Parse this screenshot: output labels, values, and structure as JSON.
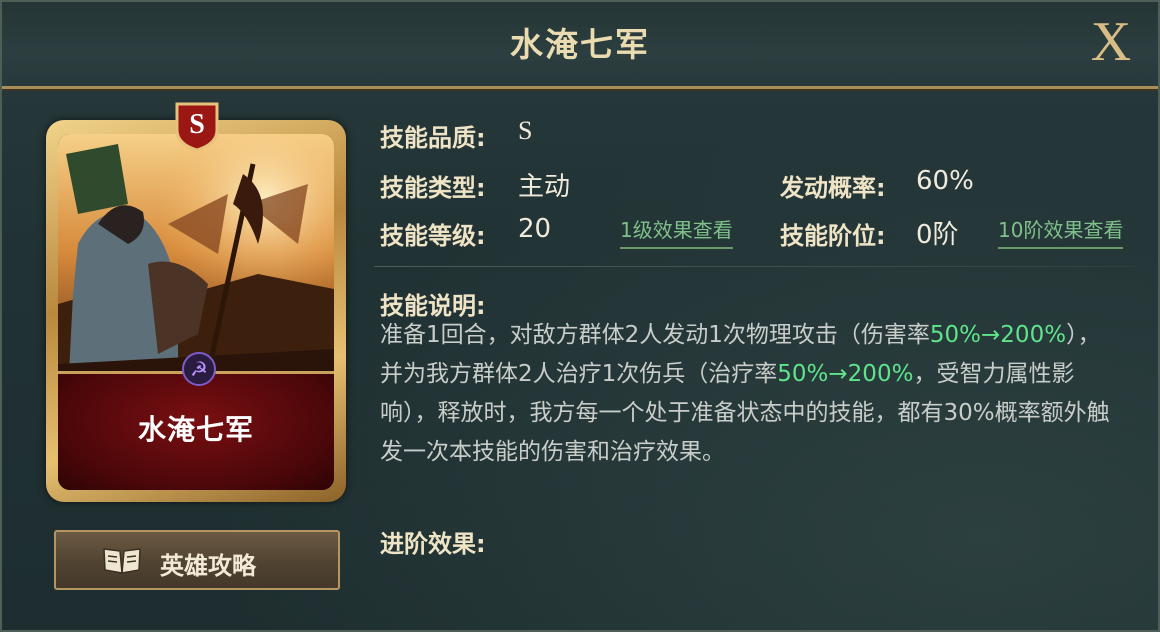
{
  "title": "水淹七军",
  "close_label": "X",
  "card": {
    "name": "水淹七军",
    "grade": "S"
  },
  "guide_button": {
    "label": "英雄攻略"
  },
  "info": {
    "quality_label": "技能品质:",
    "quality_value": "S",
    "type_label": "技能类型:",
    "type_value": "主动",
    "rate_label": "发动概率:",
    "rate_value": "60%",
    "level_label": "技能等级:",
    "level_value": "20",
    "level_link": "1级效果查看",
    "tier_label": "技能阶位:",
    "tier_value": "0阶",
    "tier_link": "10阶效果查看"
  },
  "description": {
    "label": "技能说明:",
    "p1": "准备1回合，对敌方群体2人发动1次物理攻击（伤害率",
    "h1": "50%→200%",
    "p2": "），并为我方群体2人治疗1次伤兵（治疗率",
    "h2": "50%→200%",
    "p3": "，受智力属性影响），释放时，我方每一个处于准备状态中的技能，都有30%概率额外触发一次本技能的伤害和治疗效果。"
  },
  "advance": {
    "label": "进阶效果:"
  },
  "colors": {
    "highlight": "#5ee48a",
    "gold_border": "#a98f56",
    "card_red": "#7a0f12"
  },
  "icons": [
    "close-icon",
    "grade-s-badge",
    "faction-icon",
    "book-icon"
  ]
}
